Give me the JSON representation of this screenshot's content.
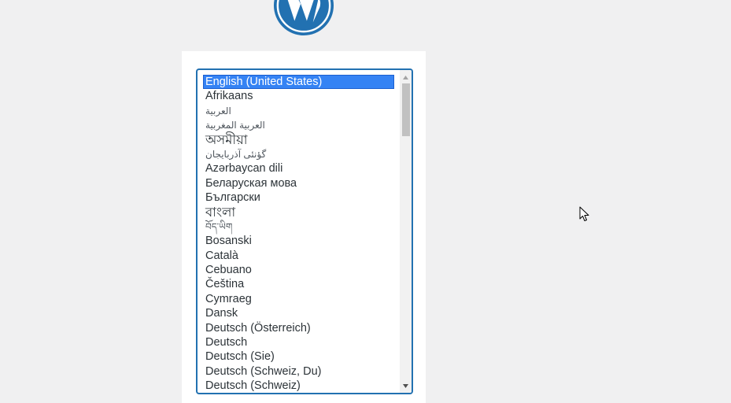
{
  "language_select": {
    "selected": "English (United States)",
    "options": [
      {
        "label": "English (United States)",
        "selected": true
      },
      {
        "label": "Afrikaans"
      },
      {
        "label": "العربية"
      },
      {
        "label": "العربية المغربية"
      },
      {
        "label": "অসমীয়া"
      },
      {
        "label": "گؤنئی آذربایجان"
      },
      {
        "label": "Azərbaycan dili"
      },
      {
        "label": "Беларуская мова"
      },
      {
        "label": "Български"
      },
      {
        "label": "বাংলা"
      },
      {
        "label": "བོད་ཡིག"
      },
      {
        "label": "Bosanski"
      },
      {
        "label": "Català"
      },
      {
        "label": "Cebuano"
      },
      {
        "label": "Čeština"
      },
      {
        "label": "Cymraeg"
      },
      {
        "label": "Dansk"
      },
      {
        "label": "Deutsch (Österreich)"
      },
      {
        "label": "Deutsch"
      },
      {
        "label": "Deutsch (Sie)"
      },
      {
        "label": "Deutsch (Schweiz, Du)"
      },
      {
        "label": "Deutsch (Schweiz)"
      }
    ]
  },
  "colors": {
    "background": "#f0f0f1",
    "accent": "#2271b1",
    "selection": "#3583f4",
    "text": "#2c3338"
  },
  "icons": {
    "logo": "wordpress-logo",
    "scroll_up": "triangle-up-icon",
    "scroll_down": "triangle-down-icon",
    "cursor": "mouse-pointer-icon"
  }
}
